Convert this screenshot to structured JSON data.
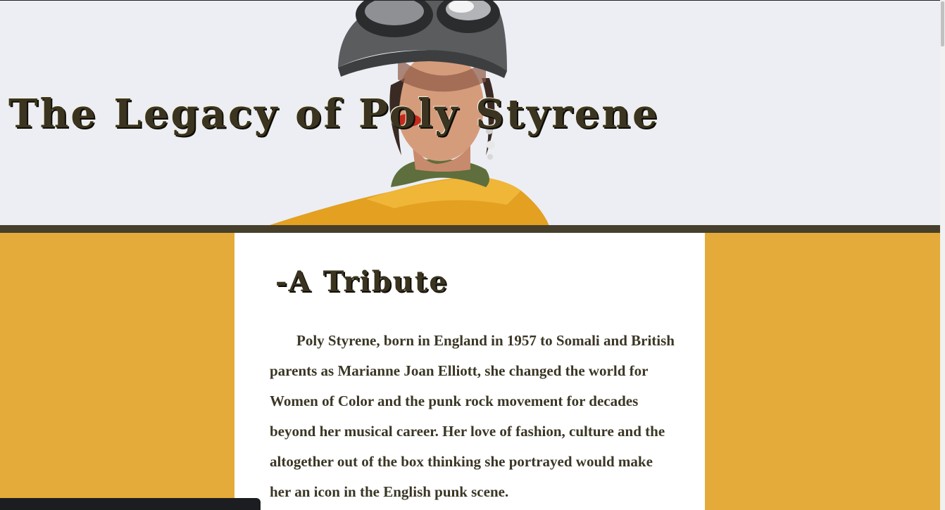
{
  "header": {
    "title": "The Legacy of Poly Styrene"
  },
  "article": {
    "subtitle": "-A Tribute",
    "paragraph": "Poly Styrene, born in England in 1957 to Somali and British parents as Marianne Joan Elliott, she changed the world for Women of Color and the punk rock movement for decades beyond her musical career. Her love of fashion, culture and the altogether out of the box thinking she portrayed would make her an icon in the English punk scene."
  },
  "colors": {
    "page_background": "#e4ab3a",
    "divider": "#463f2b",
    "heading_text": "#3a3420",
    "card_background": "#ffffff"
  }
}
